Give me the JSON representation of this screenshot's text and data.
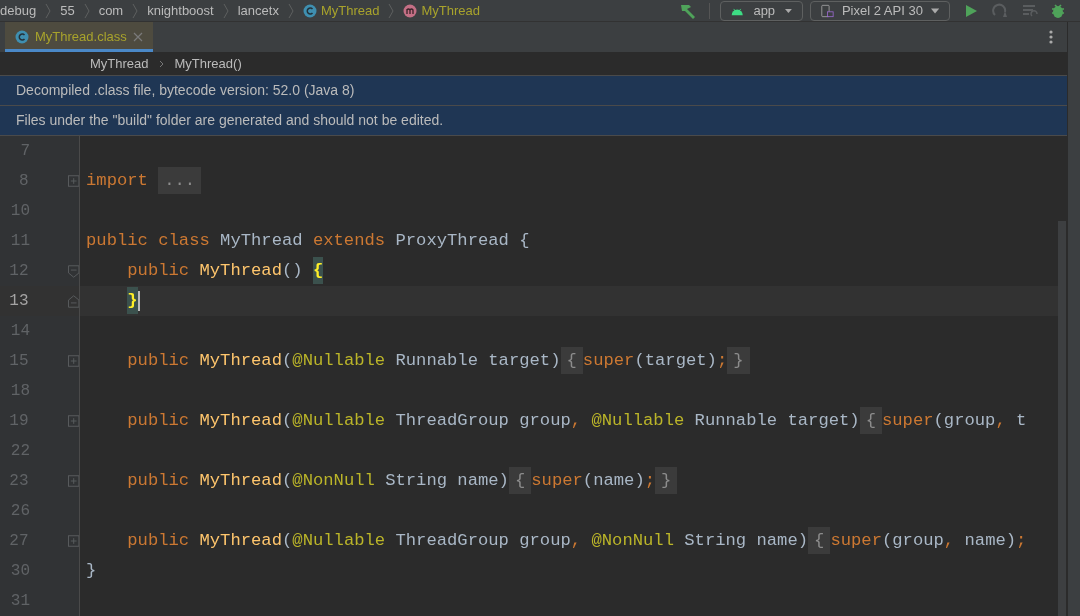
{
  "nav_bar": {
    "breadcrumbs": [
      {
        "kind": "folder",
        "label": "debug"
      },
      {
        "kind": "folder",
        "label": "55"
      },
      {
        "kind": "folder",
        "label": "com"
      },
      {
        "kind": "folder",
        "label": "knightboost"
      },
      {
        "kind": "folder",
        "label": "lancetx"
      },
      {
        "kind": "class",
        "label": "MyThread"
      },
      {
        "kind": "method",
        "label": "MyThread"
      }
    ]
  },
  "toolbar": {
    "run_configuration": "app",
    "device": "Pixel 2 API 30"
  },
  "tabs": [
    {
      "label": "MyThread.class",
      "selected": true
    }
  ],
  "editor_breadcrumbs": [
    "MyThread",
    "MyThread()"
  ],
  "banners": [
    "Decompiled .class file, bytecode version: 52.0 (Java 8)",
    "Files under the \"build\" folder are generated and should not be edited."
  ],
  "code_lines": [
    {
      "number": "7",
      "current": false
    },
    {
      "number": "8",
      "current": false,
      "fold_marker": {
        "kind": "expand"
      },
      "tokens": [
        {
          "kind": "keyword",
          "text": "import "
        },
        {
          "kind": "fold",
          "text": "..."
        }
      ]
    },
    {
      "number": "10",
      "current": false
    },
    {
      "number": "11",
      "current": false,
      "tokens": [
        {
          "kind": "keyword",
          "text": "public class "
        },
        {
          "kind": "plain",
          "text": "MyThread "
        },
        {
          "kind": "keyword",
          "text": "extends "
        },
        {
          "kind": "plain",
          "text": "ProxyThread {"
        }
      ]
    },
    {
      "number": "12",
      "current": false,
      "fold_marker": {
        "kind": "collapse_start"
      },
      "tokens": [
        {
          "kind": "keyword",
          "text": "    public "
        },
        {
          "kind": "method",
          "text": "MyThread"
        },
        {
          "kind": "plain",
          "text": "() "
        },
        {
          "kind": "brace",
          "text": "{"
        }
      ]
    },
    {
      "number": "13",
      "current": true,
      "indented": true,
      "fold_marker": {
        "kind": "collapse_end"
      },
      "tokens": [
        {
          "kind": "brace",
          "text": "}"
        }
      ]
    },
    {
      "number": "14",
      "current": false
    },
    {
      "number": "15",
      "current": false,
      "fold_marker": {
        "kind": "expand"
      },
      "tokens": [
        {
          "kind": "keyword",
          "text": "    public "
        },
        {
          "kind": "method",
          "text": "MyThread"
        },
        {
          "kind": "plain",
          "text": "("
        },
        {
          "kind": "annotation",
          "text": "@Nullable "
        },
        {
          "kind": "plain",
          "text": "Runnable target)"
        },
        {
          "kind": "fold",
          "text": "{"
        },
        {
          "kind": "keyword",
          "text": "super"
        },
        {
          "kind": "plain",
          "text": "(target)"
        },
        {
          "kind": "keyword",
          "text": ";"
        },
        {
          "kind": "fold",
          "text": "}"
        }
      ]
    },
    {
      "number": "18",
      "current": false
    },
    {
      "number": "19",
      "current": false,
      "fold_marker": {
        "kind": "expand"
      },
      "tokens": [
        {
          "kind": "keyword",
          "text": "    public "
        },
        {
          "kind": "method",
          "text": "MyThread"
        },
        {
          "kind": "plain",
          "text": "("
        },
        {
          "kind": "annotation",
          "text": "@Nullable "
        },
        {
          "kind": "plain",
          "text": "ThreadGroup group"
        },
        {
          "kind": "keyword",
          "text": ", "
        },
        {
          "kind": "annotation",
          "text": "@Nullable "
        },
        {
          "kind": "plain",
          "text": "Runnable target)"
        },
        {
          "kind": "fold",
          "text": "{"
        },
        {
          "kind": "keyword",
          "text": "super"
        },
        {
          "kind": "plain",
          "text": "(group"
        },
        {
          "kind": "keyword",
          "text": ", "
        },
        {
          "kind": "plain",
          "text": "t"
        }
      ]
    },
    {
      "number": "22",
      "current": false
    },
    {
      "number": "23",
      "current": false,
      "fold_marker": {
        "kind": "expand"
      },
      "tokens": [
        {
          "kind": "keyword",
          "text": "    public "
        },
        {
          "kind": "method",
          "text": "MyThread"
        },
        {
          "kind": "plain",
          "text": "("
        },
        {
          "kind": "annotation",
          "text": "@NonNull "
        },
        {
          "kind": "plain",
          "text": "String name)"
        },
        {
          "kind": "fold",
          "text": "{"
        },
        {
          "kind": "keyword",
          "text": "super"
        },
        {
          "kind": "plain",
          "text": "(name)"
        },
        {
          "kind": "keyword",
          "text": ";"
        },
        {
          "kind": "fold",
          "text": "}"
        }
      ]
    },
    {
      "number": "26",
      "current": false
    },
    {
      "number": "27",
      "current": false,
      "fold_marker": {
        "kind": "expand"
      },
      "tokens": [
        {
          "kind": "keyword",
          "text": "    public "
        },
        {
          "kind": "method",
          "text": "MyThread"
        },
        {
          "kind": "plain",
          "text": "("
        },
        {
          "kind": "annotation",
          "text": "@Nullable "
        },
        {
          "kind": "plain",
          "text": "ThreadGroup group"
        },
        {
          "kind": "keyword",
          "text": ", "
        },
        {
          "kind": "annotation",
          "text": "@NonNull "
        },
        {
          "kind": "plain",
          "text": "String name)"
        },
        {
          "kind": "fold",
          "text": "{"
        },
        {
          "kind": "keyword",
          "text": "super"
        },
        {
          "kind": "plain",
          "text": "(group"
        },
        {
          "kind": "keyword",
          "text": ", "
        },
        {
          "kind": "plain",
          "text": "name)"
        },
        {
          "kind": "keyword",
          "text": ";"
        }
      ]
    },
    {
      "number": "30",
      "current": false,
      "tokens": [
        {
          "kind": "plain",
          "text": "}"
        }
      ]
    },
    {
      "number": "31",
      "current": false
    }
  ]
}
